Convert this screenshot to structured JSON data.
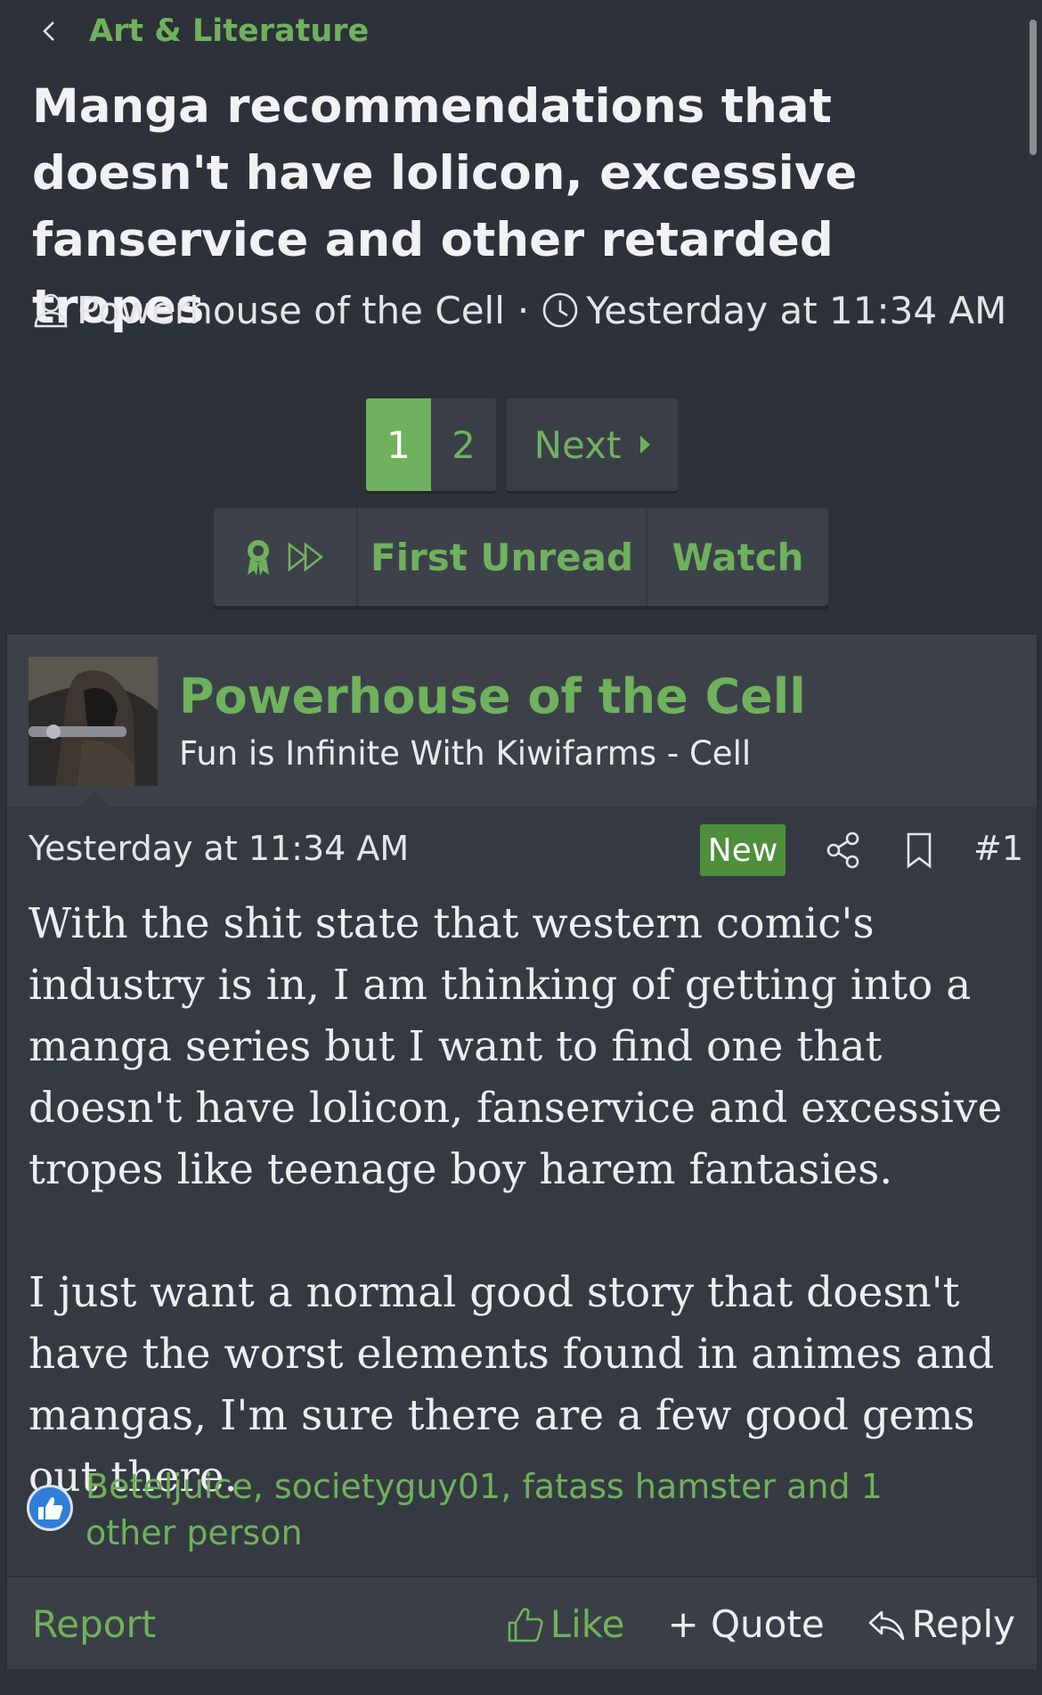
{
  "breadcrumb": {
    "label": "Art & Literature"
  },
  "thread": {
    "title": "Manga recommendations that doesn't have lolicon, excessive fanservice and other retarded tropes",
    "author": "Powerhouse of the Cell",
    "separator": "·",
    "date": "Yesterday at 11:34 AM"
  },
  "pagination": {
    "current": "1",
    "pages": [
      "1",
      "2"
    ],
    "next_label": "Next"
  },
  "thread_actions": {
    "first_unread": "First Unread",
    "watch": "Watch"
  },
  "post": {
    "username": "Powerhouse of the Cell",
    "user_title": "Fun is Infinite With Kiwifarms - Cell",
    "date": "Yesterday at 11:34 AM",
    "badge": "New",
    "number": "#1",
    "paragraphs": [
      "With the shit state that western comic's industry is in, I am thinking of getting into a manga series but I want to find one that doesn't have lolicon, fanservice and excessive tropes like teenage boy harem fantasies.",
      "I just want a normal good story that doesn't have the worst elements found in animes and mangas, I'm sure there are a few good gems out there."
    ],
    "reactions": "Beteljuice, societyguy01, fatass hamster and 1 other person",
    "actions": {
      "report": "Report",
      "like": "Like",
      "quote": "+ Quote",
      "reply": "Reply"
    }
  },
  "colors": {
    "background": "#2d3139",
    "accent": "#6fb15c",
    "card": "#353a42",
    "new_badge": "#4f8f3c",
    "like_badge": "#2f7fd8"
  }
}
